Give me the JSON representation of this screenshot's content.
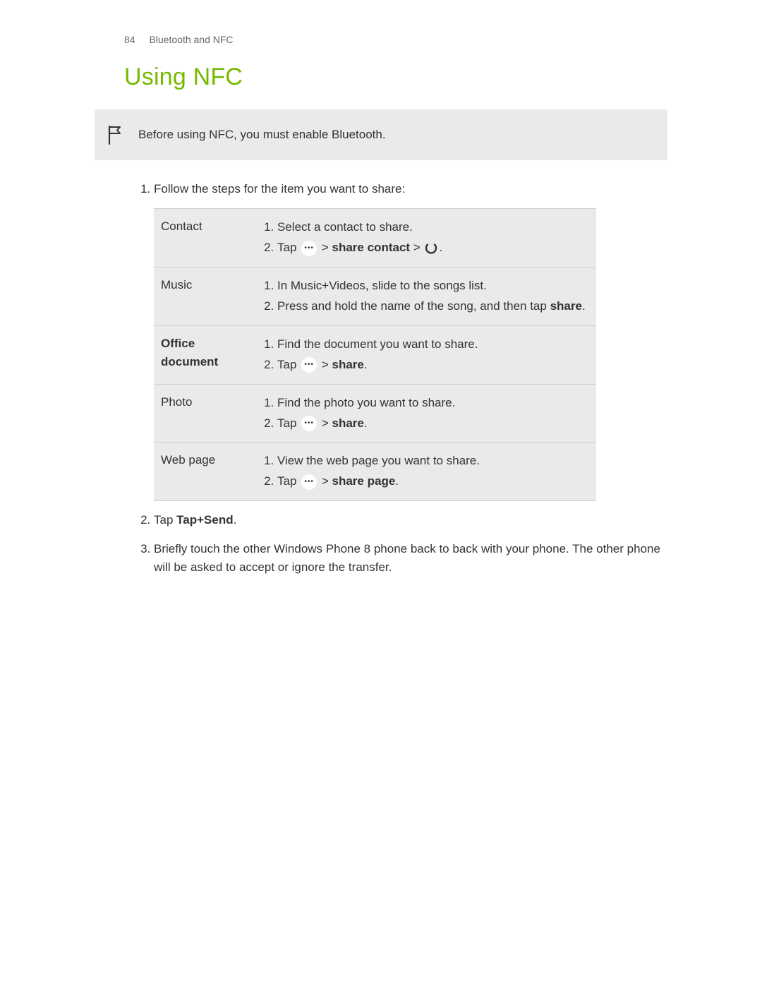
{
  "header": {
    "page_number": "84",
    "breadcrumb": "Bluetooth and NFC"
  },
  "title": "Using NFC",
  "note": "Before using NFC, you must enable Bluetooth.",
  "step1_intro": "Follow the steps for the item you want to share:",
  "table": {
    "contact": {
      "label": "Contact",
      "s1": "Select a contact to share.",
      "s2_prefix": "Tap ",
      "s2_mid": " > ",
      "s2_share": "share contact",
      "s2_end": " > ",
      "s2_period": "."
    },
    "music": {
      "label": "Music",
      "s1": "In Music+Videos, slide to the songs list.",
      "s2_prefix": "Press and hold the name of the song, and then tap ",
      "s2_share": "share",
      "s2_end": "."
    },
    "office": {
      "label": "Office document",
      "s1": "Find the document you want to share.",
      "s2_prefix": "Tap ",
      "s2_mid": " > ",
      "s2_share": "share",
      "s2_end": "."
    },
    "photo": {
      "label": "Photo",
      "s1": "Find the photo you want to share.",
      "s2_prefix": "Tap ",
      "s2_mid": " > ",
      "s2_share": "share",
      "s2_end": "."
    },
    "web": {
      "label": "Web page",
      "s1": "View the web page you want to share.",
      "s2_prefix": "Tap ",
      "s2_mid": " > ",
      "s2_share": "share page",
      "s2_end": "."
    }
  },
  "step2_prefix": "Tap ",
  "step2_bold": "Tap+Send",
  "step2_end": ".",
  "step3": "Briefly touch the other Windows Phone 8 phone back to back with your phone. The other phone will be asked to accept or ignore the transfer."
}
